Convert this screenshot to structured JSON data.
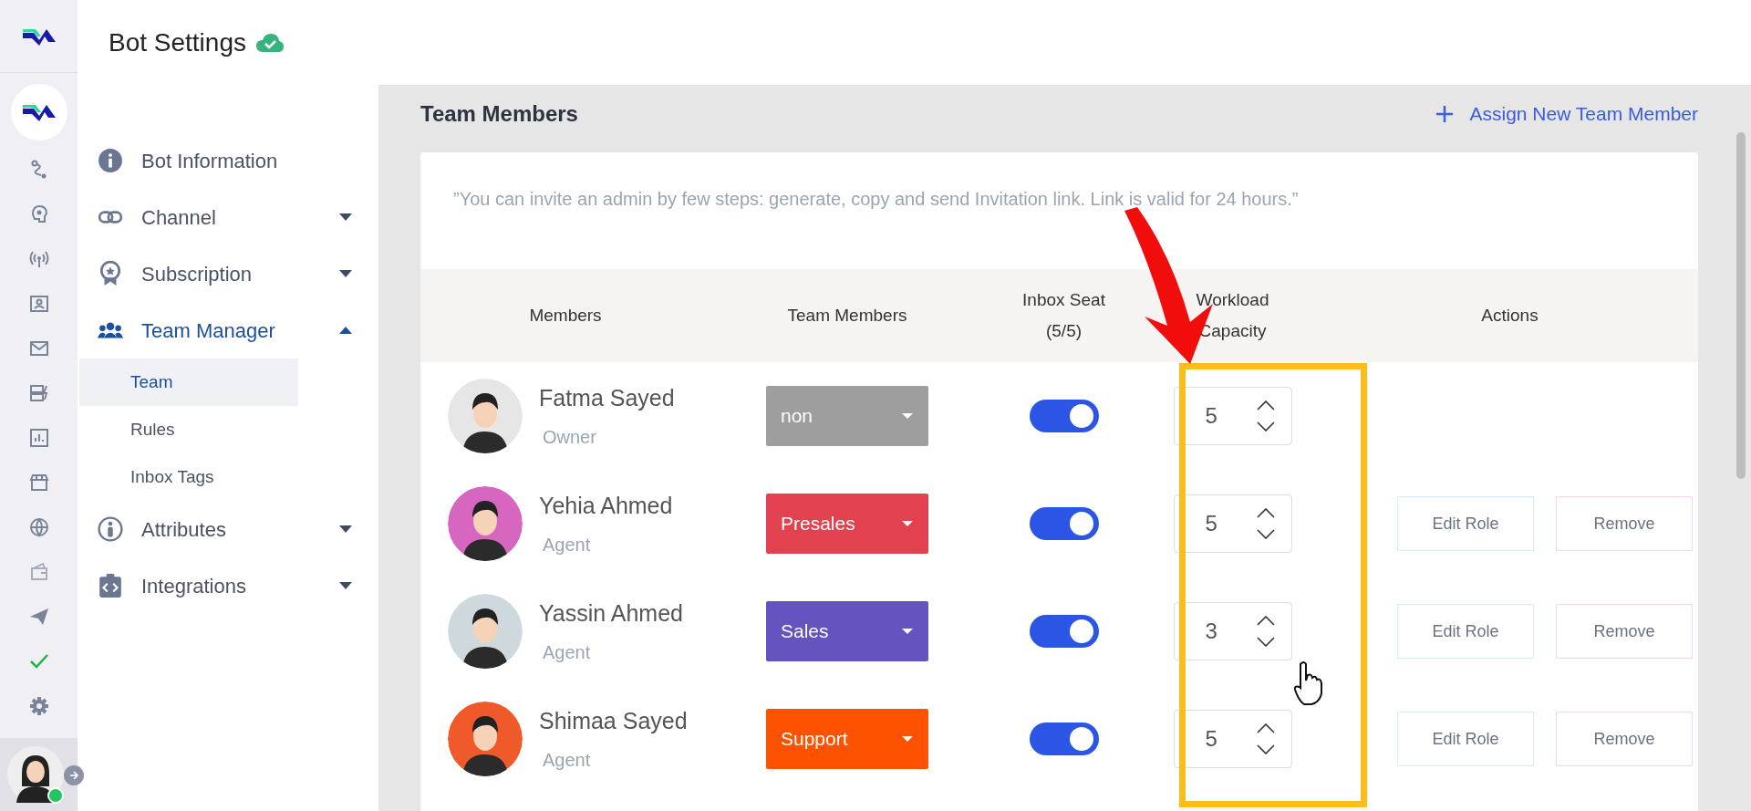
{
  "header": {
    "title": "Bot Settings"
  },
  "settings_nav": [
    {
      "label": "Bot Information"
    },
    {
      "label": "Channel",
      "expanded": false
    },
    {
      "label": "Subscription",
      "expanded": false
    },
    {
      "label": "Team Manager",
      "expanded": true,
      "children": [
        {
          "label": "Team",
          "selected": true
        },
        {
          "label": "Rules",
          "selected": false
        },
        {
          "label": "Inbox Tags",
          "selected": false
        }
      ]
    },
    {
      "label": "Attributes",
      "expanded": false
    },
    {
      "label": "Integrations",
      "expanded": false
    }
  ],
  "section": {
    "title": "Team Members",
    "action": "Assign New Team Member"
  },
  "note": "”You can invite an admin by few steps: generate, copy and send Invitation link. Link is valid for 24 hours.”",
  "table": {
    "columns": [
      "Members",
      "Team Members",
      "Inbox Seat (5/5)",
      "Workload Capacity",
      "Actions"
    ],
    "rows": [
      {
        "name": "Fatma Sayed",
        "role": "Owner",
        "team": "non",
        "color": "#9e9e9e",
        "inbox_seat": true,
        "capacity": "5",
        "actions": []
      },
      {
        "name": "Yehia Ahmed",
        "role": "Agent",
        "team": "Presales",
        "color": "#e2414f",
        "inbox_seat": true,
        "capacity": "5",
        "actions": [
          "Edit Role",
          "Remove"
        ]
      },
      {
        "name": "Yassin Ahmed",
        "role": "Agent",
        "team": "Sales",
        "color": "#6553c0",
        "inbox_seat": true,
        "capacity": "3",
        "actions": [
          "Edit Role",
          "Remove"
        ]
      },
      {
        "name": "Shimaa Sayed",
        "role": "Agent",
        "team": "Support",
        "color": "#fd5300",
        "inbox_seat": true,
        "capacity": "5",
        "actions": [
          "Edit Role",
          "Remove"
        ]
      }
    ]
  }
}
